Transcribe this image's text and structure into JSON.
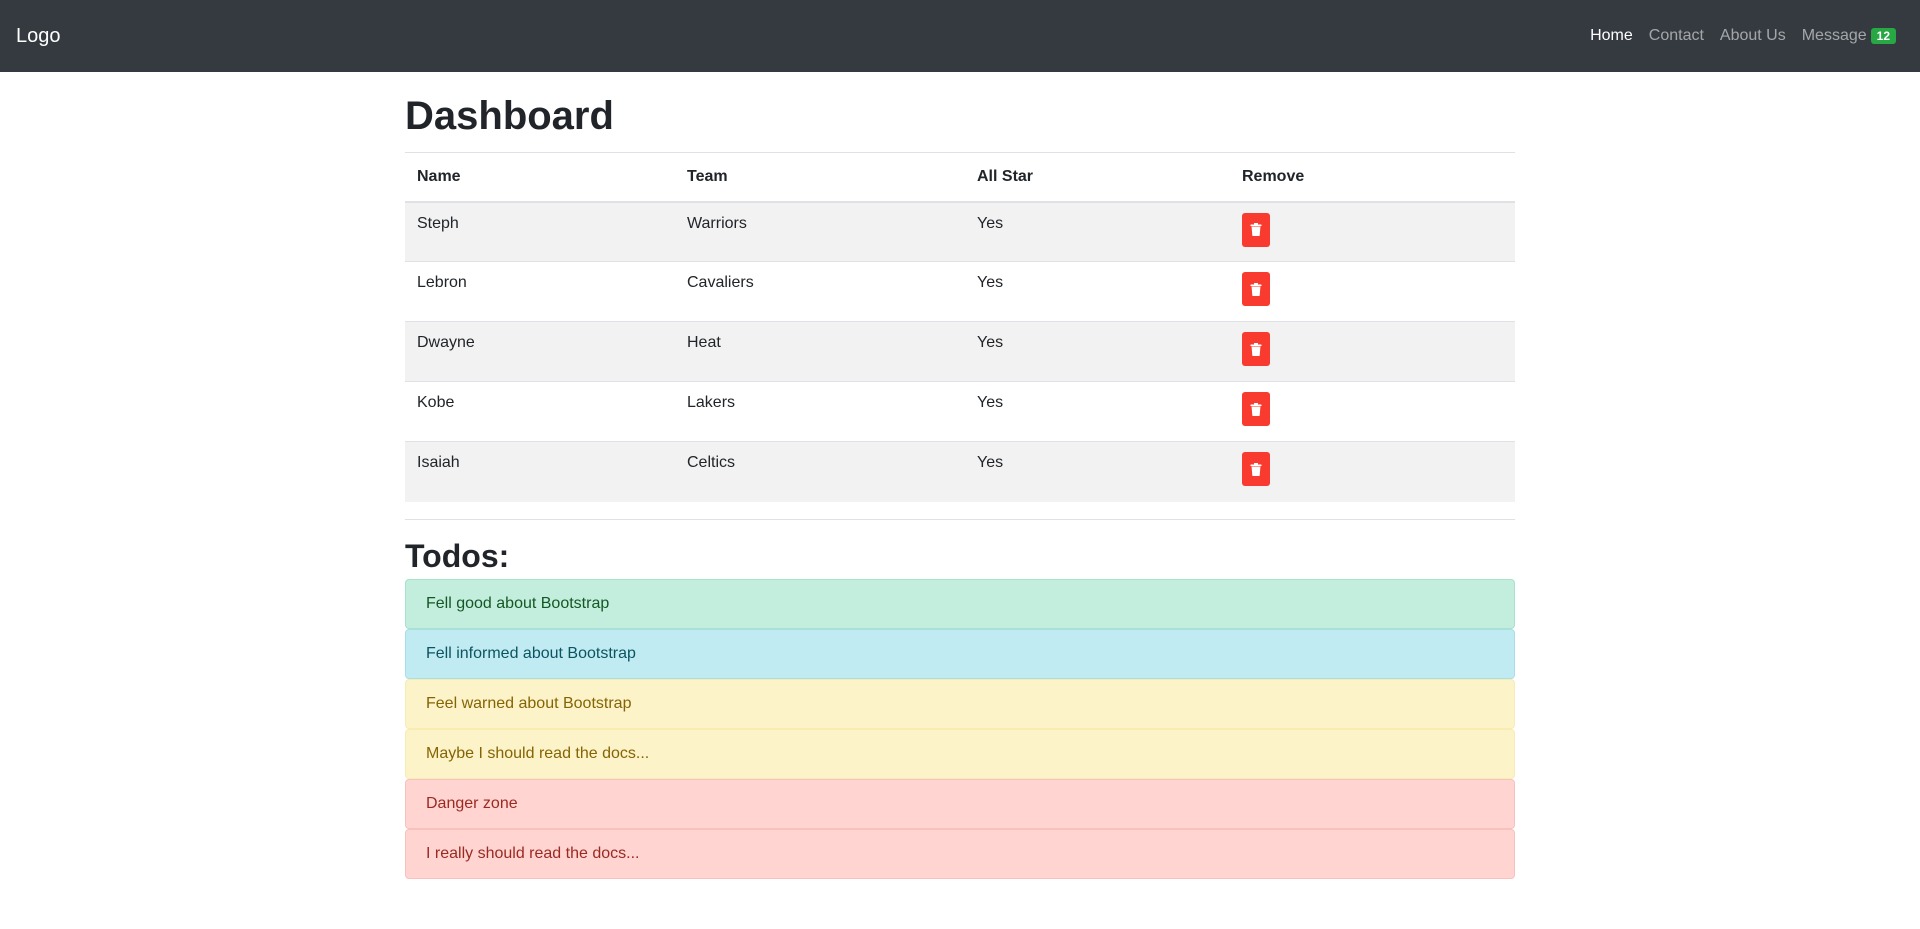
{
  "navbar": {
    "brand": "Logo",
    "links": [
      {
        "label": "Home"
      },
      {
        "label": "Contact"
      },
      {
        "label": "About Us"
      },
      {
        "label": "Message",
        "badge": "12"
      }
    ]
  },
  "dashboard": {
    "title": "Dashboard",
    "columns": [
      "Name",
      "Team",
      "All Star",
      "Remove"
    ],
    "rows": [
      {
        "name": "Steph",
        "team": "Warriors",
        "all_star": "Yes"
      },
      {
        "name": "Lebron",
        "team": "Cavaliers",
        "all_star": "Yes"
      },
      {
        "name": "Dwayne",
        "team": "Heat",
        "all_star": "Yes"
      },
      {
        "name": "Kobe",
        "team": "Lakers",
        "all_star": "Yes"
      },
      {
        "name": "Isaiah",
        "team": "Celtics",
        "all_star": "Yes"
      }
    ]
  },
  "todos": {
    "title": "Todos:",
    "items": [
      {
        "text": "Fell good about Bootstrap",
        "variant": "success"
      },
      {
        "text": "Fell informed about Bootstrap",
        "variant": "info"
      },
      {
        "text": "Feel warned about Bootstrap",
        "variant": "warning"
      },
      {
        "text": "Maybe I should read the docs...",
        "variant": "warning"
      },
      {
        "text": "Danger zone",
        "variant": "danger"
      },
      {
        "text": "I really should read the docs...",
        "variant": "danger"
      }
    ]
  },
  "colors": {
    "navbar_bg": "#343a40",
    "delete_button": "#f93a2f",
    "badge": "#28a745"
  },
  "icons": {
    "remove": "trash-icon"
  }
}
